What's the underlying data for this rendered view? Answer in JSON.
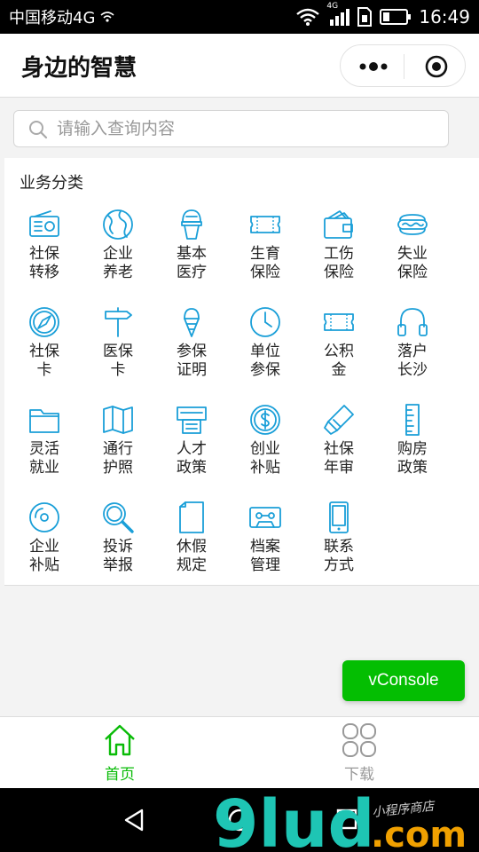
{
  "status_bar": {
    "carrier": "中国移动4G",
    "network": "4G",
    "time": "16:49"
  },
  "nav": {
    "title": "身边的智慧"
  },
  "search": {
    "placeholder": "请输入查询内容"
  },
  "section": {
    "title": "业务分类"
  },
  "categories": [
    {
      "line1": "社保",
      "line2": "转移",
      "icon": "radio-icon"
    },
    {
      "line1": "企业",
      "line2": "养老",
      "icon": "globe-icon"
    },
    {
      "line1": "基本",
      "line2": "医疗",
      "icon": "ice-cream-icon"
    },
    {
      "line1": "生育",
      "line2": "保险",
      "icon": "ticket-icon"
    },
    {
      "line1": "工伤",
      "line2": "保险",
      "icon": "wallet-icon"
    },
    {
      "line1": "失业",
      "line2": "保险",
      "icon": "hotdog-icon"
    },
    {
      "line1": "社保",
      "line2": "卡",
      "icon": "compass-icon"
    },
    {
      "line1": "医保",
      "line2": "卡",
      "icon": "signpost-icon"
    },
    {
      "line1": "参保",
      "line2": "证明",
      "icon": "ice-cream-cone-icon"
    },
    {
      "line1": "单位",
      "line2": "参保",
      "icon": "clock-icon"
    },
    {
      "line1": "公积",
      "line2": "金",
      "icon": "ticket-icon"
    },
    {
      "line1": "落户",
      "line2": "长沙",
      "icon": "headphones-icon"
    },
    {
      "line1": "灵活",
      "line2": "就业",
      "icon": "folder-icon"
    },
    {
      "line1": "通行",
      "line2": "护照",
      "icon": "map-icon"
    },
    {
      "line1": "人才",
      "line2": "政策",
      "icon": "atm-icon"
    },
    {
      "line1": "创业",
      "line2": "补贴",
      "icon": "dollar-coin-icon"
    },
    {
      "line1": "社保",
      "line2": "年审",
      "icon": "highlighter-icon"
    },
    {
      "line1": "购房",
      "line2": "政策",
      "icon": "ruler-icon"
    },
    {
      "line1": "企业",
      "line2": "补贴",
      "icon": "disc-icon"
    },
    {
      "line1": "投诉",
      "line2": "举报",
      "icon": "magnifier-icon"
    },
    {
      "line1": "休假",
      "line2": "规定",
      "icon": "document-icon"
    },
    {
      "line1": "档案",
      "line2": "管理",
      "icon": "cassette-icon"
    },
    {
      "line1": "联系",
      "line2": "方式",
      "icon": "phone-icon"
    }
  ],
  "vconsole": {
    "label": "vConsole"
  },
  "tabbar": {
    "tabs": [
      {
        "label": "首页",
        "icon": "home-icon",
        "active": true
      },
      {
        "label": "下载",
        "icon": "grid-icon",
        "active": false
      }
    ]
  },
  "watermark": {
    "text": "9lud.com",
    "subtext": "小程序商店"
  },
  "colors": {
    "icon_blue": "#1a9fd8",
    "accent_green": "#09bb07",
    "inactive_gray": "#999999"
  }
}
